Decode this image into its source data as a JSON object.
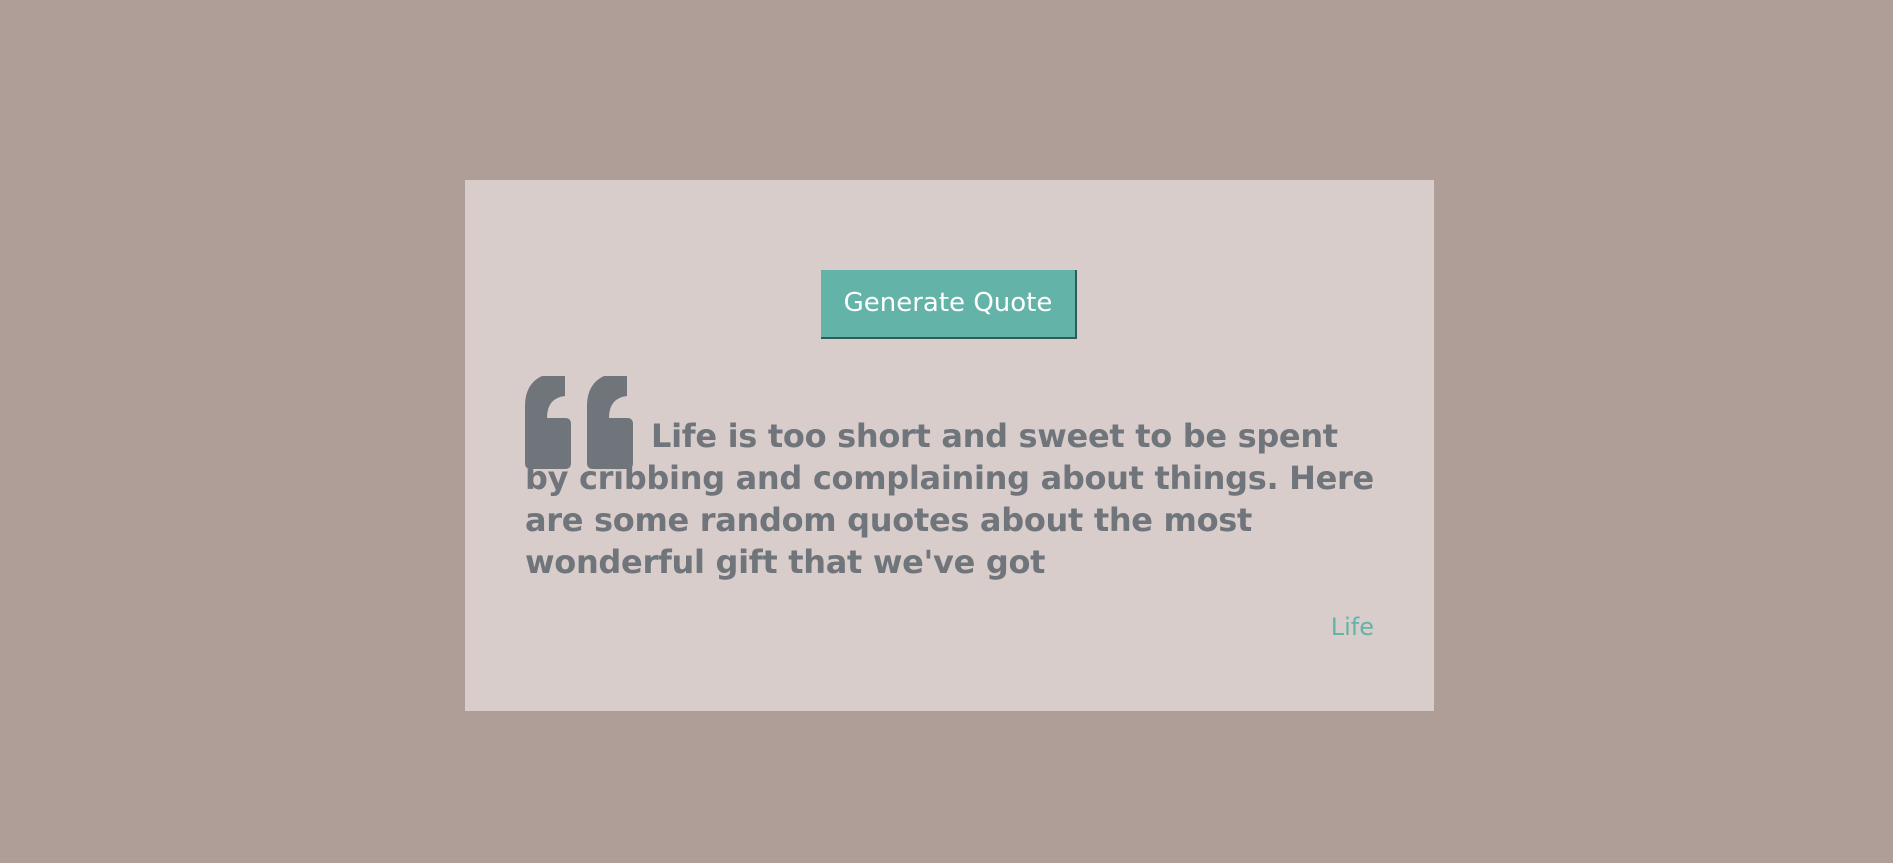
{
  "colors": {
    "background": "#ae9e97",
    "card": "#d8cdca",
    "accent": "#64b3a9",
    "text": "#6f757b"
  },
  "button": {
    "label": "Generate Quote"
  },
  "quote": {
    "icon": "quote-open-icon",
    "text": "Life is too short and sweet to be spent by cribbing and complaining about things. Here are some random quotes about the most wonderful gift that we've got",
    "author": "Life"
  }
}
